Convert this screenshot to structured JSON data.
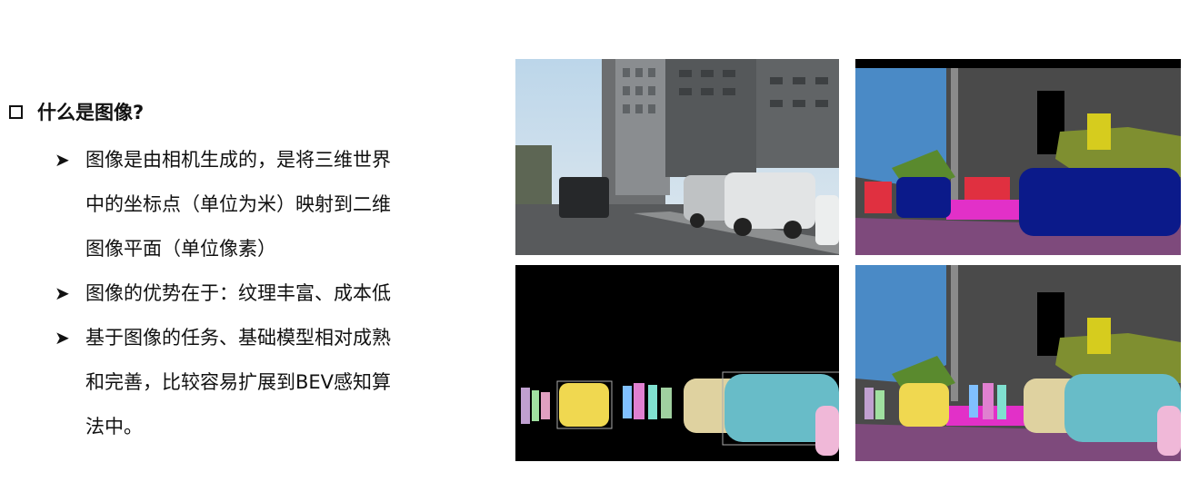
{
  "heading": "什么是图像?",
  "bullets": [
    {
      "lines": [
        "图像是由相机生成的，是将三维世界",
        "中的坐标点（单位为米）映射到二维",
        "图像平面（单位像素）"
      ]
    },
    {
      "lines": [
        "图像的优势在于：纹理丰富、成本低"
      ]
    },
    {
      "lines": [
        "基于图像的任务、基础模型相对成熟",
        "和完善，比较容易扩展到BEV感知算",
        "法中。"
      ]
    }
  ],
  "icons": {
    "bullet": "square-bullet-icon",
    "sub_bullet": "arrow-bullet-icon"
  },
  "panels": [
    {
      "name": "street-photo",
      "kind": "photo"
    },
    {
      "name": "semantic-segmentation",
      "kind": "segmentation"
    },
    {
      "name": "instance-segmentation",
      "kind": "instance"
    },
    {
      "name": "panoptic-segmentation",
      "kind": "panoptic"
    }
  ],
  "colors": {
    "sky": "#4a8ac6",
    "building": "#4a4a4a",
    "vegetation": "#7f8f30",
    "road": "#7e4a7c",
    "car": "#0b1a8a",
    "person": "#e03040",
    "sign": "#d6cc1e",
    "sidewalk": "#e230c8"
  }
}
